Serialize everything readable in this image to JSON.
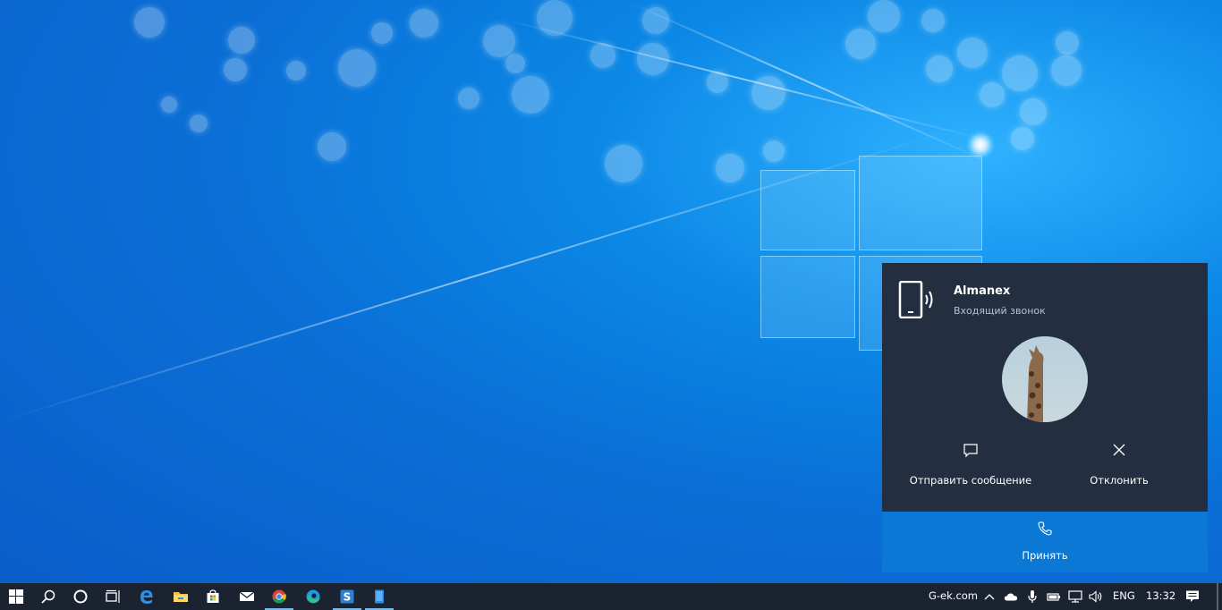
{
  "notification": {
    "caller_name": "Almanex",
    "status": "Входящий звонок",
    "actions": {
      "send_message": "Отправить сообщение",
      "decline": "Отклонить",
      "accept": "Принять"
    }
  },
  "taskbar": {
    "pinned": [
      "start-icon",
      "search-icon",
      "cortana-icon",
      "task-view-icon",
      "edge-legacy-icon",
      "file-explorer-icon",
      "store-icon",
      "mail-icon",
      "chrome-icon",
      "edge-icon",
      "snagit-icon",
      "your-phone-icon"
    ],
    "tray": {
      "site_label": "G-ek.com",
      "language": "ENG",
      "time": "13:32"
    }
  },
  "colors": {
    "toast_bg": "#232f40",
    "accept_bg": "#0a78d4",
    "taskbar_bg": "#1b2330",
    "active_indicator": "#76b9ed"
  }
}
